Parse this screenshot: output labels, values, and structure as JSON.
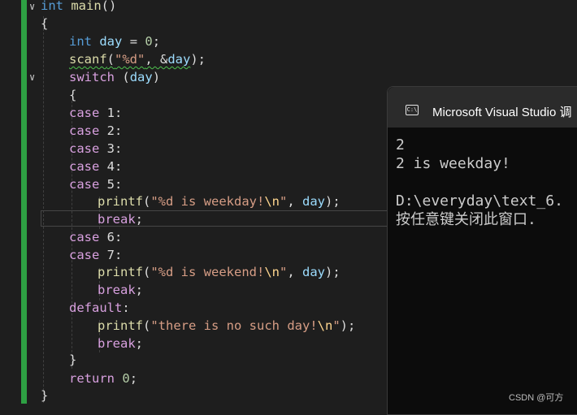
{
  "editor": {
    "lines": {
      "l1": [
        "int",
        "main",
        "()"
      ],
      "l2": "{",
      "l3": [
        "int",
        "day",
        "=",
        "0",
        ";"
      ],
      "l4": [
        "scanf",
        "(",
        "\"%d\"",
        ", &",
        "day",
        ");"
      ],
      "l5": [
        "switch",
        "(",
        "day",
        ")"
      ],
      "l6": "{",
      "case1": [
        "case",
        "1:"
      ],
      "case2": [
        "case",
        "2:"
      ],
      "case3": [
        "case",
        "3:"
      ],
      "case4": [
        "case",
        "4:"
      ],
      "case5": [
        "case",
        "5:"
      ],
      "printf1": [
        "printf",
        "(",
        "\"%d is weekday!",
        "\\n",
        "\"",
        ", ",
        "day",
        ");"
      ],
      "break1": [
        "break",
        ";"
      ],
      "case6": [
        "case",
        "6:"
      ],
      "case7": [
        "case",
        "7:"
      ],
      "printf2": [
        "printf",
        "(",
        "\"%d is weekend!",
        "\\n",
        "\"",
        ", ",
        "day",
        ");"
      ],
      "break2": [
        "break",
        ";"
      ],
      "default": [
        "default",
        ":"
      ],
      "printf3": [
        "printf",
        "(",
        "\"there is no such day!",
        "\\n",
        "\"",
        ");"
      ],
      "break3": [
        "break",
        ";"
      ],
      "close_switch": "}",
      "return": [
        "return",
        "0",
        ";"
      ],
      "close_main": "}"
    }
  },
  "console": {
    "title": "Microsoft Visual Studio 调",
    "icon": "console-icon",
    "icon_glyph": "C:\\",
    "output": [
      "2",
      "2 is weekday!",
      "",
      "D:\\everyday\\text_6.",
      "按任意键关闭此窗口."
    ]
  },
  "watermark": "CSDN @可方",
  "colors": {
    "keyword": "#569cd6",
    "control": "#d8a0df",
    "function": "#dcdcaa",
    "variable": "#9cdcfe",
    "string": "#d69d85",
    "change_bar": "#2ea043"
  }
}
